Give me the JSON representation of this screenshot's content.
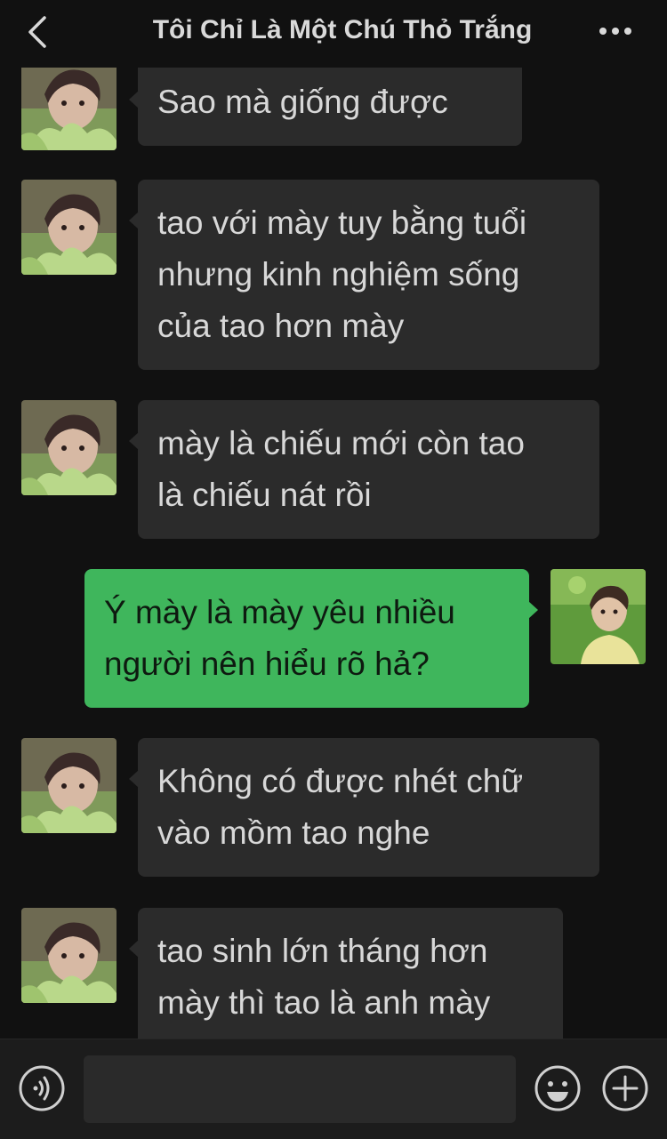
{
  "header": {
    "title": "Tôi Chỉ Là Một Chú Thỏ Trắng",
    "back_icon": "chevron-left-icon",
    "more_icon": "more-dots-icon"
  },
  "messages": [
    {
      "sender": "contact",
      "lines": [
        "Sao mà giống được"
      ]
    },
    {
      "sender": "contact",
      "lines": [
        "tao với mày tuy bằng tuổi",
        "nhưng kinh nghiệm sống",
        "của tao hơn mày"
      ]
    },
    {
      "sender": "contact",
      "lines": [
        "mày là chiếu mới còn tao",
        "là chiếu nát rồi"
      ]
    },
    {
      "sender": "self",
      "lines": [
        "Ý mày là mày yêu nhiều",
        "người nên hiểu rõ hả?"
      ]
    },
    {
      "sender": "contact",
      "lines": [
        "Không có được nhét chữ",
        "vào mồm tao nghe"
      ]
    },
    {
      "sender": "contact",
      "lines": [
        "tao sinh lớn tháng hơn",
        "mày thì tao là anh mày"
      ]
    }
  ],
  "footer": {
    "input_value": "",
    "voice_icon": "voice-icon",
    "emoji_icon": "emoji-icon",
    "plus_icon": "plus-icon"
  },
  "colors": {
    "background": "#111111",
    "incoming_bubble": "#2b2b2b",
    "outgoing_bubble": "#3fb65c",
    "text": "#d8d8d8"
  }
}
